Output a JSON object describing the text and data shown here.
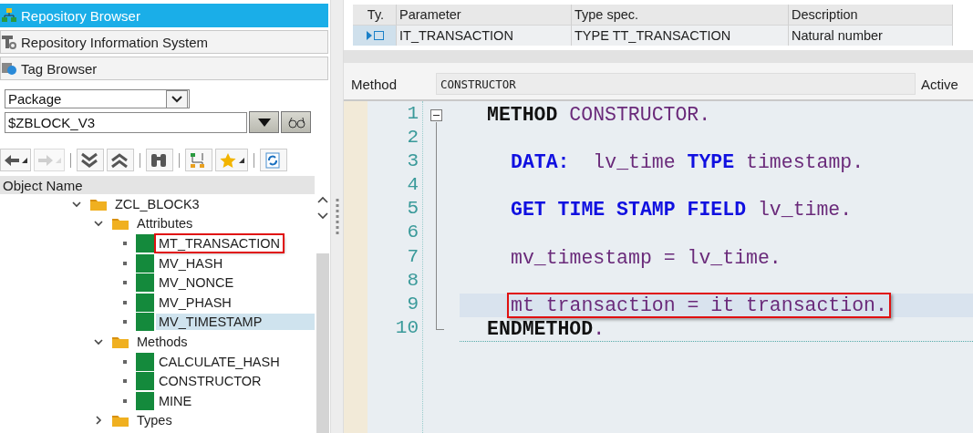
{
  "nav_tabs": [
    {
      "label": "Repository Browser",
      "selected": true
    },
    {
      "label": "Repository Information System",
      "selected": false
    },
    {
      "label": "Tag Browser",
      "selected": false
    }
  ],
  "object_type": {
    "value": "Package"
  },
  "object_name": {
    "value": "$ZBLOCK_V3"
  },
  "toolbar": [
    {
      "kind": "back",
      "disabled": false
    },
    {
      "kind": "forward",
      "disabled": true
    },
    {
      "kind": "expand",
      "disabled": false
    },
    {
      "kind": "collapse",
      "disabled": false
    },
    {
      "kind": "find",
      "disabled": false
    },
    {
      "kind": "hierarchy",
      "disabled": false
    },
    {
      "kind": "favorite",
      "disabled": false
    },
    {
      "kind": "refresh",
      "disabled": false
    }
  ],
  "tree": {
    "header": "Object Name",
    "items": [
      {
        "label": "ZCL_BLOCK3",
        "kind": "folder",
        "expanded": true,
        "selected": false,
        "marked": false,
        "children": [
          {
            "label": "Attributes",
            "kind": "folder",
            "expanded": true,
            "selected": false,
            "marked": false,
            "children": [
              {
                "label": "MT_TRANSACTION",
                "kind": "element",
                "selected": false,
                "marked": true
              },
              {
                "label": "MV_HASH",
                "kind": "element",
                "selected": false,
                "marked": false
              },
              {
                "label": "MV_NONCE",
                "kind": "element",
                "selected": false,
                "marked": false
              },
              {
                "label": "MV_PHASH",
                "kind": "element",
                "selected": false,
                "marked": false
              },
              {
                "label": "MV_TIMESTAMP",
                "kind": "element",
                "selected": true,
                "marked": false
              }
            ]
          },
          {
            "label": "Methods",
            "kind": "folder",
            "expanded": true,
            "selected": false,
            "marked": false,
            "children": [
              {
                "label": "CALCULATE_HASH",
                "kind": "element",
                "selected": false,
                "marked": false
              },
              {
                "label": "CONSTRUCTOR",
                "kind": "element",
                "selected": false,
                "marked": false
              },
              {
                "label": "MINE",
                "kind": "element",
                "selected": false,
                "marked": false
              }
            ]
          },
          {
            "label": "Types",
            "kind": "folder",
            "expanded": false,
            "selected": false,
            "marked": false
          }
        ]
      }
    ]
  },
  "parameters": {
    "columns": [
      "Ty.",
      "Parameter",
      "Type spec.",
      "Description"
    ],
    "rows": [
      {
        "cells": [
          "",
          "IT_TRANSACTION",
          "TYPE TT_TRANSACTION",
          "Natural number"
        ],
        "selected": true
      }
    ]
  },
  "method": {
    "label": "Method",
    "value": "CONSTRUCTOR",
    "status": "Active"
  },
  "editor": {
    "lines": [
      {
        "number": "1",
        "indented": false,
        "current": false,
        "marked": false,
        "tokens": [
          {
            "kind": "block",
            "text": "METHOD "
          },
          {
            "kind": "name",
            "text": "CONSTRUCTOR."
          }
        ]
      },
      {
        "number": "2"
      },
      {
        "number": "3",
        "indented": true,
        "current": false,
        "marked": false,
        "tokens": [
          {
            "kind": "keyword",
            "text": "DATA:  "
          },
          {
            "kind": "name",
            "text": "lv_time "
          },
          {
            "kind": "keyword",
            "text": "TYPE "
          },
          {
            "kind": "name",
            "text": "timestamp."
          }
        ]
      },
      {
        "number": "4"
      },
      {
        "number": "5",
        "indented": true,
        "current": false,
        "marked": false,
        "tokens": [
          {
            "kind": "keyword",
            "text": "GET TIME STAMP FIELD "
          },
          {
            "kind": "name",
            "text": "lv_time."
          }
        ]
      },
      {
        "number": "6"
      },
      {
        "number": "7",
        "indented": true,
        "current": false,
        "marked": false,
        "tokens": [
          {
            "kind": "name",
            "text": "mv_timestamp = lv_time."
          }
        ]
      },
      {
        "number": "8"
      },
      {
        "number": "9",
        "indented": true,
        "current": true,
        "marked": true,
        "tokens": [
          {
            "kind": "name",
            "text": "mt transaction = it transaction."
          }
        ]
      },
      {
        "number": "10",
        "indented": false,
        "current": false,
        "marked": false,
        "tokens": [
          {
            "kind": "block",
            "text": "ENDMETHOD"
          },
          {
            "kind": "name",
            "text": "."
          }
        ]
      }
    ]
  }
}
